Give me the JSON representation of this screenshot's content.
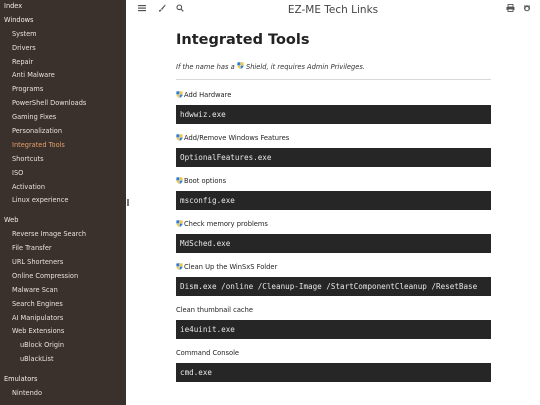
{
  "sidebar": {
    "items": [
      {
        "label": "Index",
        "level": "part"
      },
      {
        "label": "Windows",
        "level": "part"
      },
      {
        "label": "System",
        "level": "chapter"
      },
      {
        "label": "Drivers",
        "level": "chapter"
      },
      {
        "label": "Repair",
        "level": "chapter"
      },
      {
        "label": "Anti Malware",
        "level": "chapter"
      },
      {
        "label": "Programs",
        "level": "chapter"
      },
      {
        "label": "PowerShell Downloads",
        "level": "chapter"
      },
      {
        "label": "Gaming Fixes",
        "level": "chapter"
      },
      {
        "label": "Personalization",
        "level": "chapter"
      },
      {
        "label": "Integrated Tools",
        "level": "chapter",
        "active": true
      },
      {
        "label": "Shortcuts",
        "level": "chapter"
      },
      {
        "label": "ISO",
        "level": "chapter"
      },
      {
        "label": "Activation",
        "level": "chapter"
      },
      {
        "label": "Linux experience",
        "level": "chapter"
      },
      {
        "label": "Web",
        "level": "part",
        "gap_before": true
      },
      {
        "label": "Reverse Image Search",
        "level": "chapter"
      },
      {
        "label": "File Transfer",
        "level": "chapter"
      },
      {
        "label": "URL Shorteners",
        "level": "chapter"
      },
      {
        "label": "Online Compression",
        "level": "chapter"
      },
      {
        "label": "Malware Scan",
        "level": "chapter"
      },
      {
        "label": "Search Engines",
        "level": "chapter"
      },
      {
        "label": "AI Manipulators",
        "level": "chapter"
      },
      {
        "label": "Web Extensions",
        "level": "chapter"
      },
      {
        "label": "uBlock Origin",
        "level": "sub"
      },
      {
        "label": "uBlackList",
        "level": "sub"
      },
      {
        "label": "Emulators",
        "level": "part",
        "gap_before": true
      },
      {
        "label": "Nintendo",
        "level": "chapter"
      }
    ],
    "accent_color": "#e6a06a",
    "background": "#3a302c"
  },
  "menubar": {
    "title": "EZ-ME Tech Links",
    "left_icons": [
      "menu-icon",
      "paintbrush-icon",
      "search-icon"
    ],
    "right_icons": [
      "print-icon",
      "github-icon"
    ]
  },
  "page": {
    "title": "Integrated Tools",
    "note": "If the name has a  Shield, it requires Admin Privileges.",
    "items": [
      {
        "label": "Add Hardware",
        "shield": true,
        "command": "hdwwiz.exe"
      },
      {
        "label": "Add/Remove Windows Features",
        "shield": true,
        "command": "OptionalFeatures.exe"
      },
      {
        "label": "Boot options",
        "shield": true,
        "command": "msconfig.exe"
      },
      {
        "label": "Check memory problems",
        "shield": true,
        "command": "MdSched.exe"
      },
      {
        "label": "Clean Up the WinSxS Folder",
        "shield": true,
        "command": "Dism.exe /online /Cleanup-Image /StartComponentCleanup /ResetBase"
      },
      {
        "label": "Clean thumbnail cache",
        "shield": false,
        "command": "ie4uinit.exe"
      },
      {
        "label": "Command Console",
        "shield": false,
        "command": "cmd.exe"
      }
    ]
  }
}
